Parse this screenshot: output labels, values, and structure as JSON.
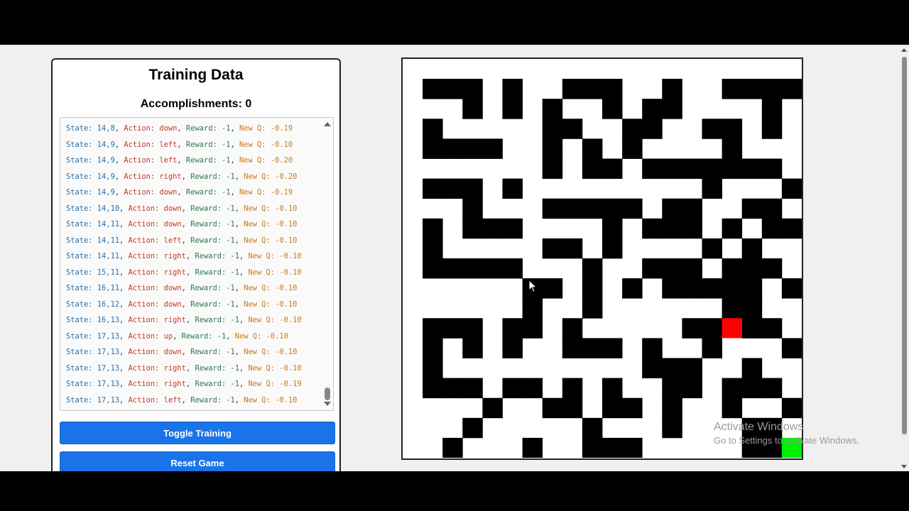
{
  "panel": {
    "title": "Training Data",
    "accomplishments_label": "Accomplishments:",
    "accomplishments_value": "0"
  },
  "log": {
    "labels": {
      "state": "State:",
      "action": "Action:",
      "reward": "Reward:",
      "new_q": "New Q:"
    },
    "entries": [
      {
        "state": "14,8",
        "action": "down",
        "reward": "-1",
        "new_q": "-0.19"
      },
      {
        "state": "14,9",
        "action": "left",
        "reward": "-1",
        "new_q": "-0.10"
      },
      {
        "state": "14,9",
        "action": "left",
        "reward": "-1",
        "new_q": "-0.20"
      },
      {
        "state": "14,9",
        "action": "right",
        "reward": "-1",
        "new_q": "-0.20"
      },
      {
        "state": "14,9",
        "action": "down",
        "reward": "-1",
        "new_q": "-0.19"
      },
      {
        "state": "14,10",
        "action": "down",
        "reward": "-1",
        "new_q": "-0.10"
      },
      {
        "state": "14,11",
        "action": "down",
        "reward": "-1",
        "new_q": "-0.10"
      },
      {
        "state": "14,11",
        "action": "left",
        "reward": "-1",
        "new_q": "-0.10"
      },
      {
        "state": "14,11",
        "action": "right",
        "reward": "-1",
        "new_q": "-0.10"
      },
      {
        "state": "15,11",
        "action": "right",
        "reward": "-1",
        "new_q": "-0.10"
      },
      {
        "state": "16,11",
        "action": "down",
        "reward": "-1",
        "new_q": "-0.10"
      },
      {
        "state": "16,12",
        "action": "down",
        "reward": "-1",
        "new_q": "-0.10"
      },
      {
        "state": "16,13",
        "action": "right",
        "reward": "-1",
        "new_q": "-0.10"
      },
      {
        "state": "17,13",
        "action": "up",
        "reward": "-1",
        "new_q": "-0.10"
      },
      {
        "state": "17,13",
        "action": "down",
        "reward": "-1",
        "new_q": "-0.10"
      },
      {
        "state": "17,13",
        "action": "right",
        "reward": "-1",
        "new_q": "-0.10"
      },
      {
        "state": "17,13",
        "action": "right",
        "reward": "-1",
        "new_q": "-0.19"
      },
      {
        "state": "17,13",
        "action": "left",
        "reward": "-1",
        "new_q": "-0.10"
      }
    ]
  },
  "buttons": {
    "toggle_training": "Toggle Training",
    "reset_game": "Reset Game"
  },
  "maze": {
    "rows": 20,
    "cols": 20,
    "wall_color": "#000000",
    "path_color": "#ffffff",
    "agent_color": "#ff0000",
    "goal_color": "#00ee00",
    "agent": [
      16,
      13
    ],
    "goal": [
      19,
      19
    ],
    "grid": [
      "....................",
      ".###.#..###..#..####",
      "...#.#.#..#.##....#.",
      ".#.....##..##..##.#.",
      ".####..#.#.#....#...",
      ".......#.##.#######.",
      ".###.#.........#...#",
      "...#...#####.##..##.",
      ".#.###....#.###.#.##",
      ".#.....##.#....#.#..",
      ".#####...#..###.###.",
      "......##.#.#.#####.#",
      "......#..#......##..",
      ".###.##.#.....##.##.",
      ".#.#.#..###.#..#...#",
      ".#..........###..#...",
      ".###.##.#.#..##.###.",
      "....#..##.##.#..#..#",
      "...#.....#...#...##.",
      "..#...#..###.....##."
    ],
    "grid_note_ignore": ""
  },
  "watermark": {
    "title": "Activate Windows",
    "subtitle": "Go to Settings to activate Windows."
  }
}
